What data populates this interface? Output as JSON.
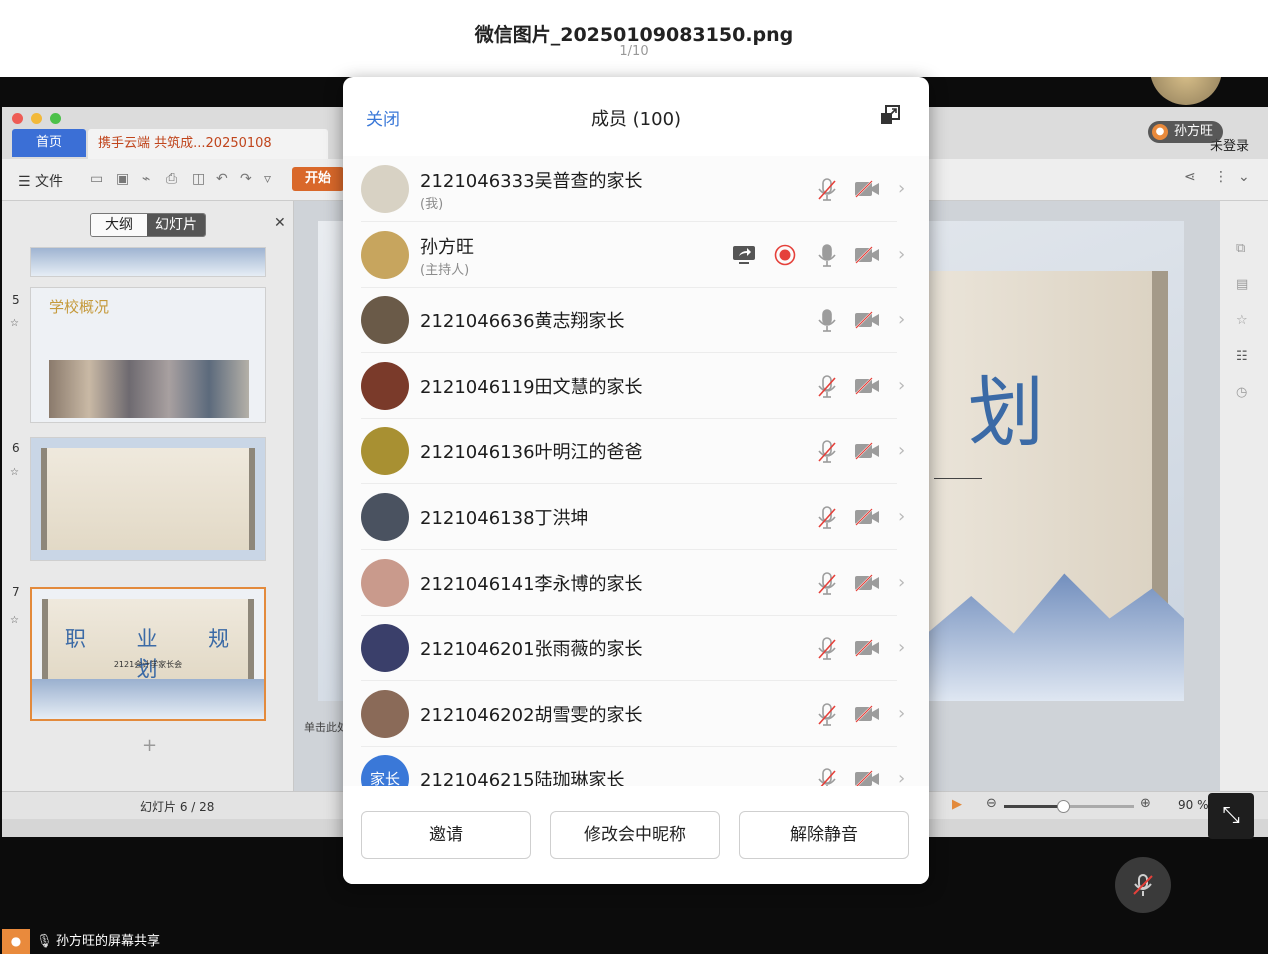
{
  "viewer": {
    "title": "微信图片_20250109083150.png",
    "counter": "1/10"
  },
  "wps": {
    "tab_home": "首页",
    "tab_doc": "携手云端 共筑成...20250108",
    "menu_file": "文件",
    "start_button": "开始",
    "seg_outline": "大纲",
    "seg_slides": "幻灯片",
    "not_logged_in": "未登录",
    "slide_count": "幻灯片 6 / 28",
    "zoom": "90 %",
    "zoom_fraction": 0.45,
    "click_hint": "单击此处",
    "thumbs": [
      {
        "num": "5",
        "title": "学校概况"
      },
      {
        "num": "6"
      },
      {
        "num": "7",
        "word": "职 业 规 划",
        "sub": "2121会计学家长会"
      }
    ],
    "main_slide_word": "划"
  },
  "host": {
    "name_tag": "孙方旺"
  },
  "share_label": "孙方旺的屏幕共享",
  "modal": {
    "close": "关闭",
    "title": "成员 (100)",
    "members": [
      {
        "name": "2121046333吴普查的家长",
        "sub": "(我)",
        "avatar_color": "#d8d2c4",
        "mic_muted": true,
        "cam_off": true
      },
      {
        "name": "孙方旺",
        "sub": "(主持人)",
        "avatar_color": "#c7a55e",
        "mic_muted": false,
        "cam_off": true,
        "sharing": true,
        "recording": true
      },
      {
        "name": "2121046636黄志翔家长",
        "avatar_color": "#6a5a48",
        "mic_muted": false,
        "cam_off": true
      },
      {
        "name": "2121046119田文慧的家长",
        "avatar_color": "#7a3a2a",
        "mic_muted": true,
        "cam_off": true
      },
      {
        "name": "2121046136叶明江的爸爸",
        "avatar_color": "#a89032",
        "mic_muted": true,
        "cam_off": true
      },
      {
        "name": "2121046138丁洪坤",
        "avatar_color": "#4a5260",
        "mic_muted": true,
        "cam_off": true
      },
      {
        "name": "2121046141李永博的家长",
        "avatar_color": "#c99a8c",
        "mic_muted": true,
        "cam_off": true
      },
      {
        "name": "2121046201张雨薇的家长",
        "avatar_color": "#3a3f6a",
        "mic_muted": true,
        "cam_off": true
      },
      {
        "name": "2121046202胡雪雯的家长",
        "avatar_color": "#8a6a58",
        "mic_muted": true,
        "cam_off": true
      },
      {
        "name": "2121046215陆珈琳家长",
        "avatar_text": "家长",
        "avatar_color": "#3a78d8",
        "mic_muted": true,
        "cam_off": true
      }
    ],
    "buttons": {
      "invite": "邀请",
      "rename": "修改会中昵称",
      "unmute": "解除静音"
    }
  },
  "colors": {
    "accent": "#3a78d8",
    "record": "#e5403a",
    "muted_icon": "#9c9c9c"
  }
}
